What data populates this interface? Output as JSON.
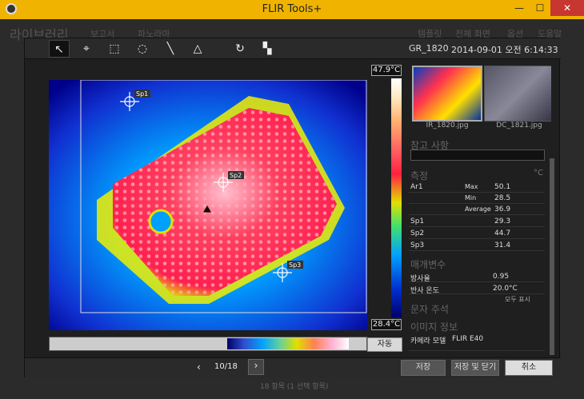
{
  "window": {
    "title": "FLIR Tools+"
  },
  "background_app": {
    "library_label": "라이브러리",
    "menu_items": [
      "보고서",
      "파노라마",
      "템플릿",
      "전체 화면",
      "옵션",
      "도움말"
    ],
    "status": "18 항목  (1 선택 항목)"
  },
  "toolbar": {
    "file_name": "GR_1820",
    "date": "2014-09-01 오전 6:14:33"
  },
  "scale": {
    "max": "47.9°C",
    "min": "28.4°C"
  },
  "spots": {
    "sp1": "Sp1",
    "sp2": "Sp2",
    "sp3": "Sp3"
  },
  "auto_button": "자동",
  "thumbnails": [
    {
      "label": "IR_1820.jpg"
    },
    {
      "label": "DC_1821.jpg"
    }
  ],
  "notes": {
    "title": "참고 사항"
  },
  "measure": {
    "title": "측정",
    "unit": "°C",
    "rows": [
      {
        "name": "Ar1",
        "stat": "Max",
        "value": "50.1"
      },
      {
        "name": "",
        "stat": "Min",
        "value": "28.5"
      },
      {
        "name": "",
        "stat": "Average",
        "value": "36.9"
      },
      {
        "name": "Sp1",
        "stat": "",
        "value": "29.3"
      },
      {
        "name": "Sp2",
        "stat": "",
        "value": "44.7"
      },
      {
        "name": "Sp3",
        "stat": "",
        "value": "31.4"
      }
    ]
  },
  "params": {
    "title": "매개변수",
    "emissivity_label": "방사율",
    "emissivity_value": "0.95",
    "reflected_label": "반사 온도",
    "reflected_value": "20.0°C",
    "show_all": "모두 표시"
  },
  "text_annotation": {
    "title": "문자 주석"
  },
  "image_info": {
    "title": "이미지 정보",
    "camera_label": "카메라 모델",
    "camera_value": "FLIR E40"
  },
  "navigation": {
    "counter": "10/18"
  },
  "footer": {
    "save": "저장",
    "save_close": "저장 및 닫기",
    "cancel": "취소"
  }
}
